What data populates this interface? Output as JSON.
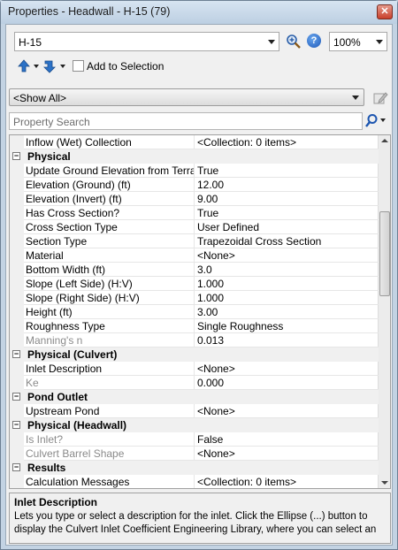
{
  "window": {
    "title": "Properties - Headwall - H-15 (79)"
  },
  "toolbar": {
    "element_selector": "H-15",
    "zoom_level": "100%",
    "add_to_selection_label": "Add to Selection",
    "add_to_selection_checked": false
  },
  "filter": {
    "selected": "<Show All>"
  },
  "search": {
    "placeholder": "Property Search"
  },
  "grid": {
    "rows": [
      {
        "kind": "prop",
        "name": "Inflow (Wet) Collection",
        "value": "<Collection: 0 items>"
      },
      {
        "kind": "cat",
        "name": "Physical"
      },
      {
        "kind": "prop",
        "name": "Update Ground Elevation from Terrain",
        "value": "True"
      },
      {
        "kind": "prop",
        "name": "Elevation (Ground) (ft)",
        "value": "12.00"
      },
      {
        "kind": "prop",
        "name": "Elevation (Invert) (ft)",
        "value": "9.00"
      },
      {
        "kind": "prop",
        "name": "Has Cross Section?",
        "value": "True"
      },
      {
        "kind": "prop",
        "name": "Cross Section Type",
        "value": "User Defined"
      },
      {
        "kind": "prop",
        "name": "Section Type",
        "value": "Trapezoidal Cross Section"
      },
      {
        "kind": "prop",
        "name": "Material",
        "value": "<None>"
      },
      {
        "kind": "prop",
        "name": "Bottom Width (ft)",
        "value": "3.0"
      },
      {
        "kind": "prop",
        "name": "Slope (Left Side) (H:V)",
        "value": "1.000"
      },
      {
        "kind": "prop",
        "name": "Slope (Right Side) (H:V)",
        "value": "1.000"
      },
      {
        "kind": "prop",
        "name": "Height (ft)",
        "value": "3.00"
      },
      {
        "kind": "prop",
        "name": "Roughness Type",
        "value": "Single Roughness"
      },
      {
        "kind": "prop",
        "name": "Manning's n",
        "value": "0.013",
        "disabled": true
      },
      {
        "kind": "cat",
        "name": "Physical (Culvert)"
      },
      {
        "kind": "prop",
        "name": "Inlet Description",
        "value": "<None>"
      },
      {
        "kind": "prop",
        "name": "Ke",
        "value": "0.000",
        "disabled": true
      },
      {
        "kind": "cat",
        "name": "Pond Outlet"
      },
      {
        "kind": "prop",
        "name": "Upstream Pond",
        "value": "<None>"
      },
      {
        "kind": "cat",
        "name": "Physical (Headwall)"
      },
      {
        "kind": "prop",
        "name": "Is Inlet?",
        "value": "False",
        "disabled": true
      },
      {
        "kind": "prop",
        "name": "Culvert Barrel Shape",
        "value": "<None>",
        "disabled": true
      },
      {
        "kind": "cat",
        "name": "Results"
      },
      {
        "kind": "prop",
        "name": "Calculation Messages",
        "value": "<Collection: 0 items>"
      }
    ]
  },
  "description": {
    "title": "Inlet Description",
    "text": "Lets you type or select a description for the inlet. Click the Ellipse (...) button to display the Culvert Inlet Coefficient Engineering Library, where you can select an e..."
  }
}
